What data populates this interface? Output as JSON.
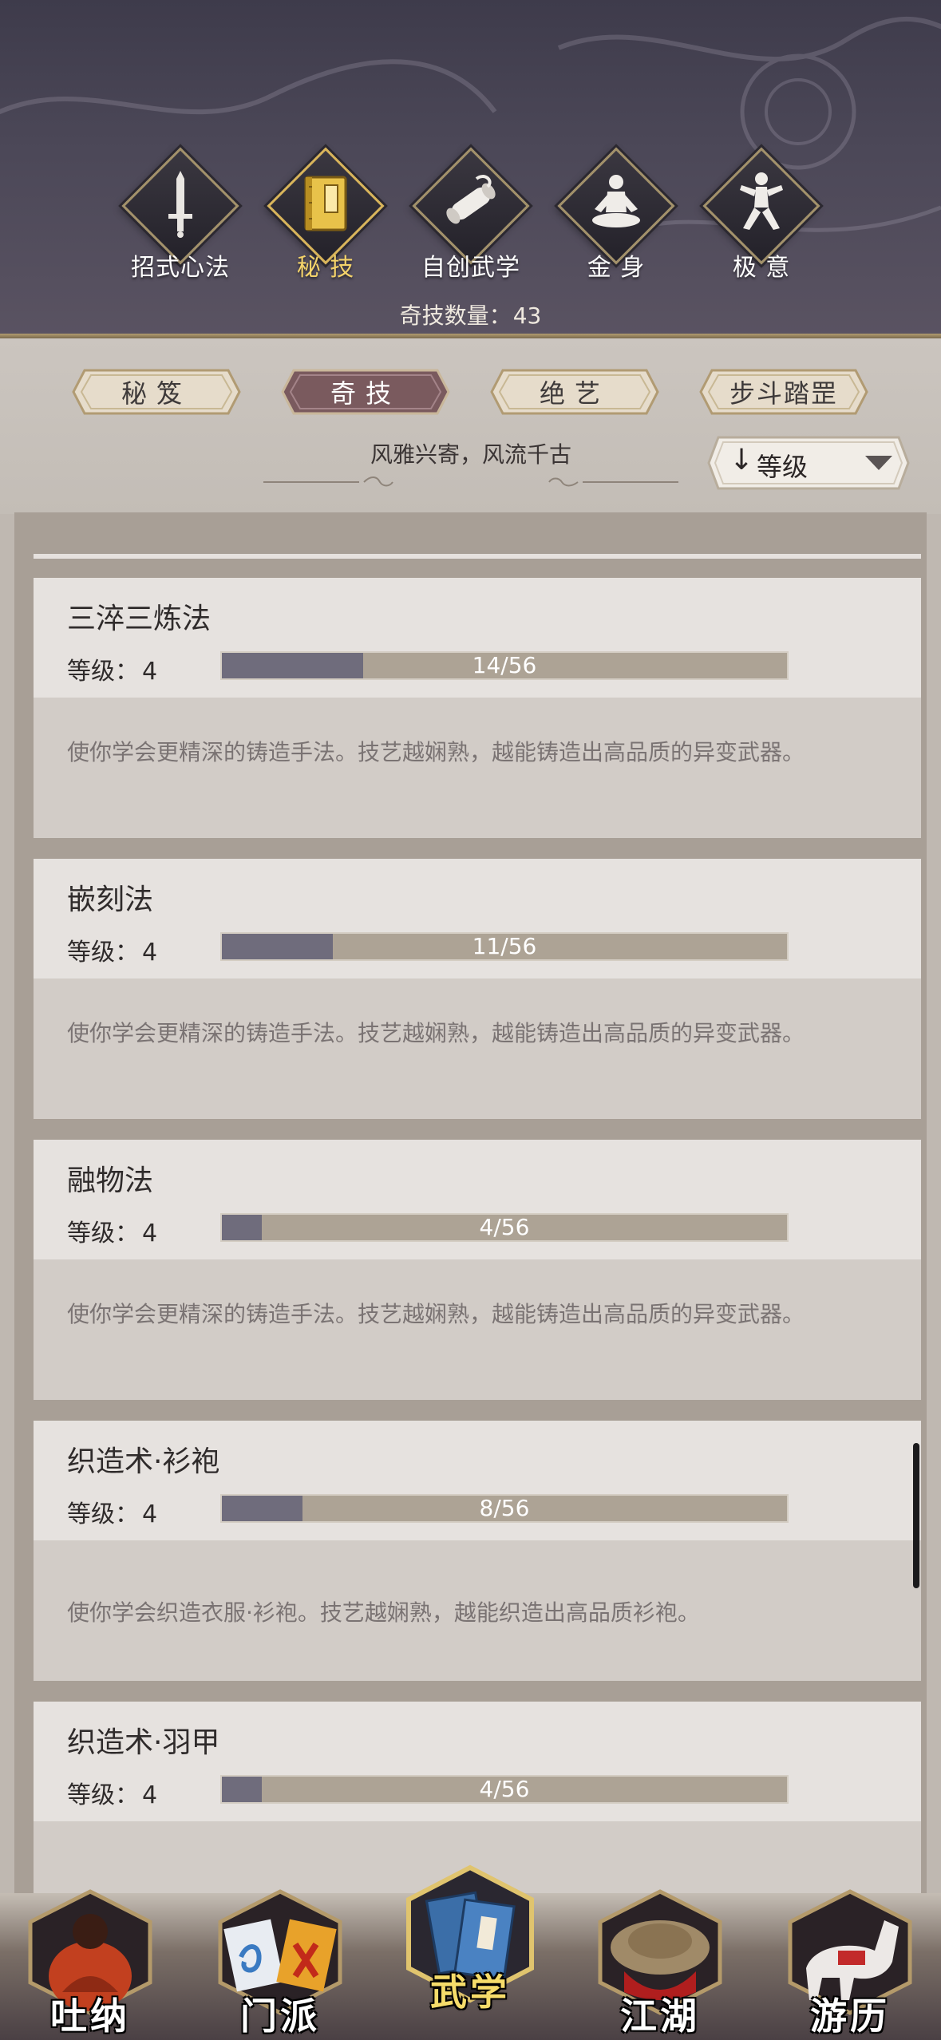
{
  "header": {
    "categories": [
      {
        "label": "招式心法",
        "icon": "sword-icon"
      },
      {
        "label": "秘 技",
        "icon": "book-icon"
      },
      {
        "label": "自创武学",
        "icon": "scroll-icon"
      },
      {
        "label": "金 身",
        "icon": "meditation-icon"
      },
      {
        "label": "极 意",
        "icon": "martial-stance-icon"
      }
    ],
    "active_category": "秘 技",
    "count_label": "奇技数量：",
    "count_value": "43"
  },
  "subtabs": [
    {
      "label": "秘笈"
    },
    {
      "label": "奇技"
    },
    {
      "label": "绝艺"
    },
    {
      "label": "步斗踏罡"
    }
  ],
  "active_subtab": "奇技",
  "tagline": "风雅兴寄，风流千古",
  "sort": {
    "arrow": "↓",
    "label": "等级"
  },
  "items": [
    {
      "name": "三淬三炼法",
      "level_label": "等级：",
      "level": "4",
      "progress_text": "14/56",
      "progress": 0.25,
      "desc": "使你学会更精深的铸造手法。技艺越娴熟，越能铸造出高品质的异变武器。"
    },
    {
      "name": "嵌刻法",
      "level_label": "等级：",
      "level": "4",
      "progress_text": "11/56",
      "progress": 0.196,
      "desc": "使你学会更精深的铸造手法。技艺越娴熟，越能铸造出高品质的异变武器。"
    },
    {
      "name": "融物法",
      "level_label": "等级：",
      "level": "4",
      "progress_text": "4/56",
      "progress": 0.071,
      "desc": "使你学会更精深的铸造手法。技艺越娴熟，越能铸造出高品质的异变武器。"
    },
    {
      "name": "织造术·衫袍",
      "level_label": "等级：",
      "level": "4",
      "progress_text": "8/56",
      "progress": 0.143,
      "desc": "使你学会织造衣服·衫袍。技艺越娴熟，越能织造出高品质衫袍。"
    },
    {
      "name": "织造术·羽甲",
      "level_label": "等级：",
      "level": "4",
      "progress_text": "4/56",
      "progress": 0.071,
      "desc": ""
    }
  ],
  "bottom_nav": [
    {
      "label": "吐纳",
      "icon": "monk-icon"
    },
    {
      "label": "门派",
      "icon": "sect-flags-icon"
    },
    {
      "label": "武学",
      "icon": "martial-book-icon"
    },
    {
      "label": "江湖",
      "icon": "bamboo-hat-icon"
    },
    {
      "label": "游历",
      "icon": "horse-icon"
    }
  ],
  "active_nav": "武学",
  "colors": {
    "header_bg": "#45414f",
    "active_gold": "#f4d36a",
    "progress_fill": "#6f6c7c",
    "progress_track": "#ada395",
    "active_tab": "#7a5a5e"
  }
}
